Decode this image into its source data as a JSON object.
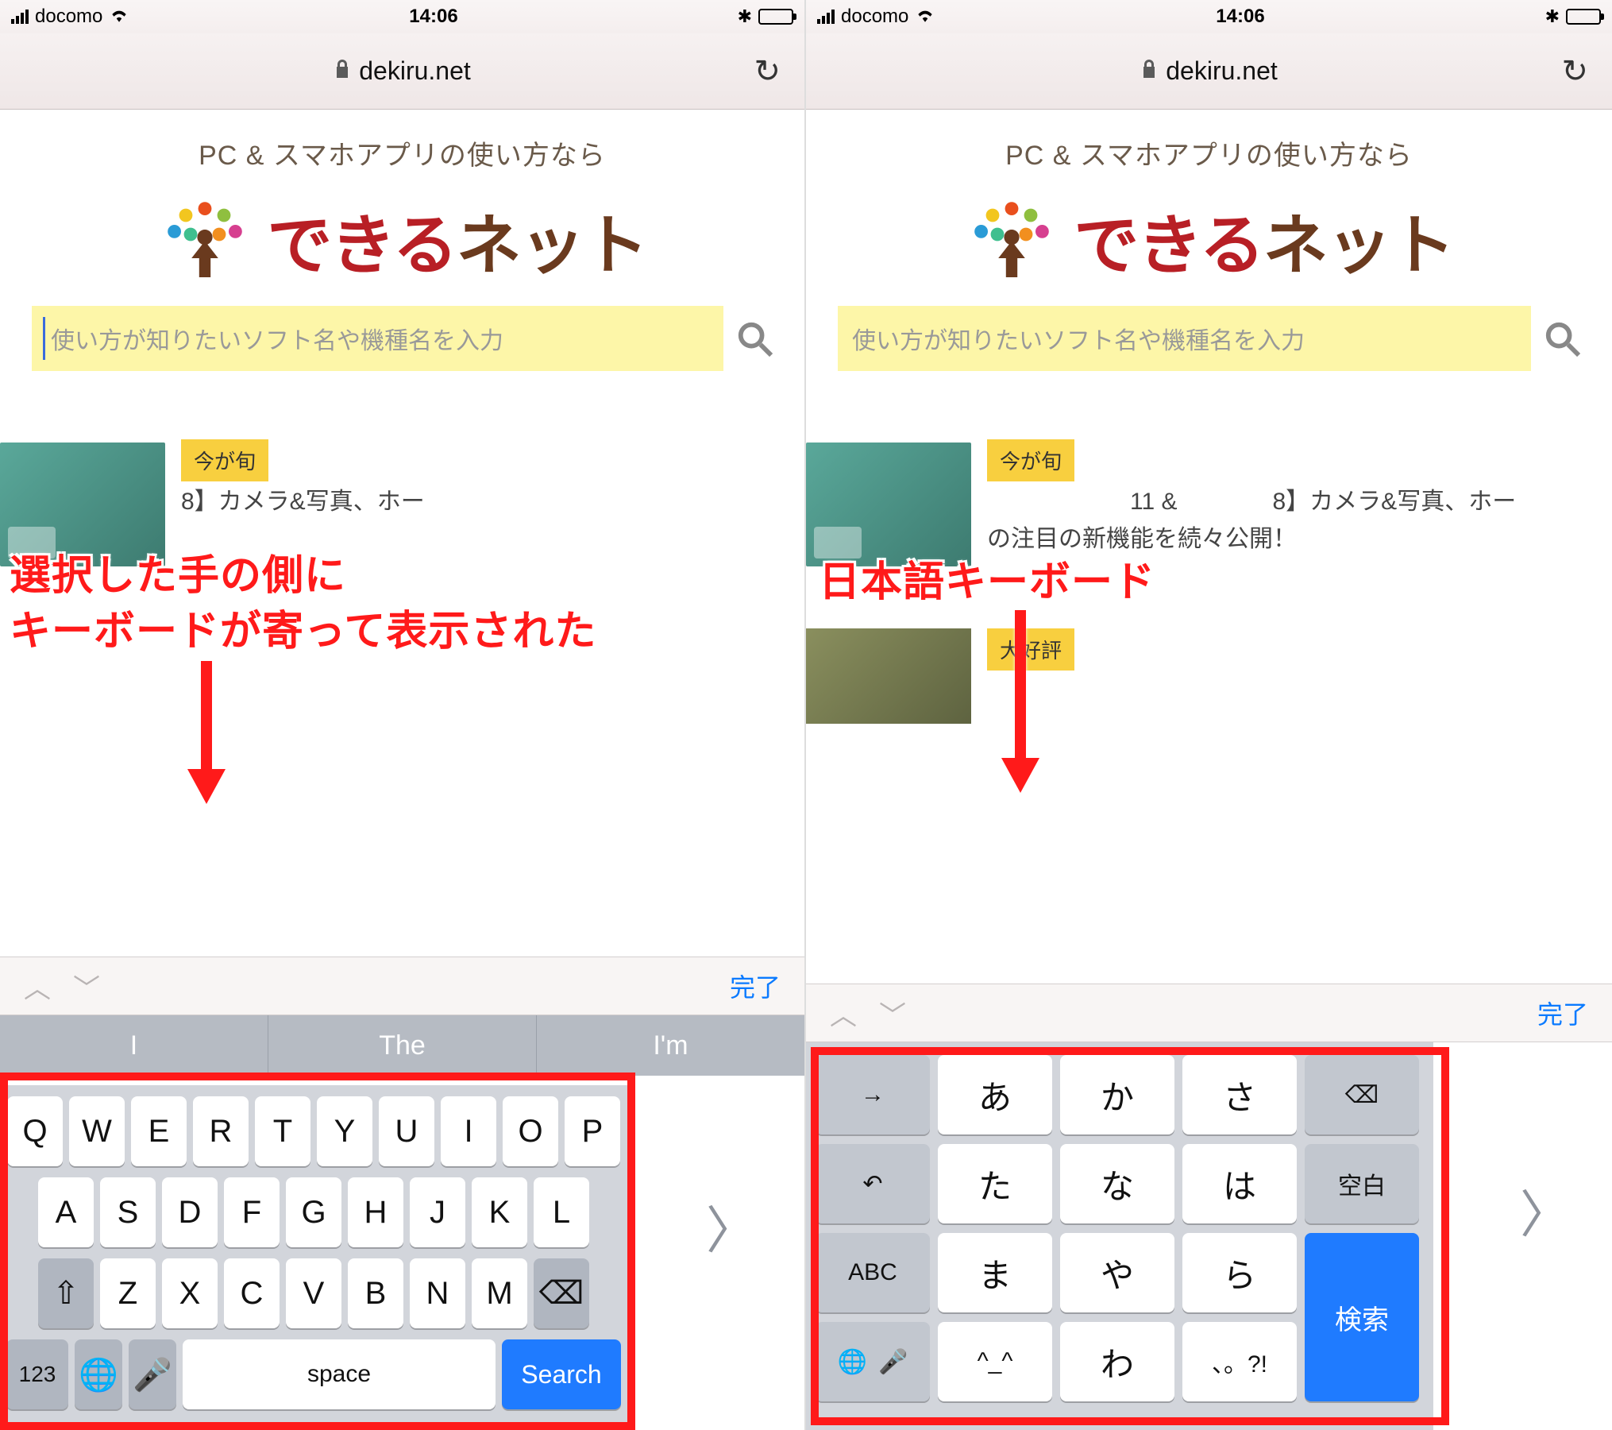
{
  "status": {
    "carrier": "docomo",
    "time": "14:06"
  },
  "nav": {
    "domain": "dekiru.net"
  },
  "page": {
    "tagline": "PC & スマホアプリの使い方なら",
    "logo_main": "できる",
    "logo_sub": "ネット",
    "search_placeholder": "使い方が知りたいソフト名や機種名を入力",
    "badge_trending": "今が旬",
    "badge_popular": "大好評",
    "article_r_line": "8】カメラ&写真、ホー",
    "article_r_line2_prefix": "の注目の新機能を続々公開！",
    "article_r_mid": "11 &"
  },
  "accessory": {
    "done": "完了"
  },
  "predictive": [
    "I",
    "The",
    "I'm"
  ],
  "qwerty": {
    "row1": [
      "Q",
      "W",
      "E",
      "R",
      "T",
      "Y",
      "U",
      "I",
      "O",
      "P"
    ],
    "row2": [
      "A",
      "S",
      "D",
      "F",
      "G",
      "H",
      "J",
      "K",
      "L"
    ],
    "row3": [
      "Z",
      "X",
      "C",
      "V",
      "B",
      "N",
      "M"
    ],
    "num": "123",
    "space": "space",
    "search": "Search"
  },
  "kana": {
    "rows": [
      [
        "→",
        "あ",
        "か",
        "さ",
        "⌫"
      ],
      [
        "↶",
        "た",
        "な",
        "は",
        "空白"
      ],
      [
        "ABC",
        "ま",
        "や",
        "ら",
        "検索"
      ],
      [
        "🌐",
        "🎤",
        "^_^",
        "わ",
        "、。?!",
        ""
      ]
    ],
    "tab": "→",
    "a": "あ",
    "ka": "か",
    "sa": "さ",
    "del": "⌫",
    "undo": "↶",
    "ta": "た",
    "na": "な",
    "ha": "は",
    "space": "空白",
    "abc": "ABC",
    "ma": "ま",
    "ya": "や",
    "ra": "ら",
    "search": "検索",
    "face": "^_^",
    "wa": "わ",
    "punct": "、。?!"
  },
  "annotations": {
    "left_line1": "選択した手の側に",
    "left_line2": "キーボードが寄って表示された",
    "right": "日本語キーボード"
  }
}
